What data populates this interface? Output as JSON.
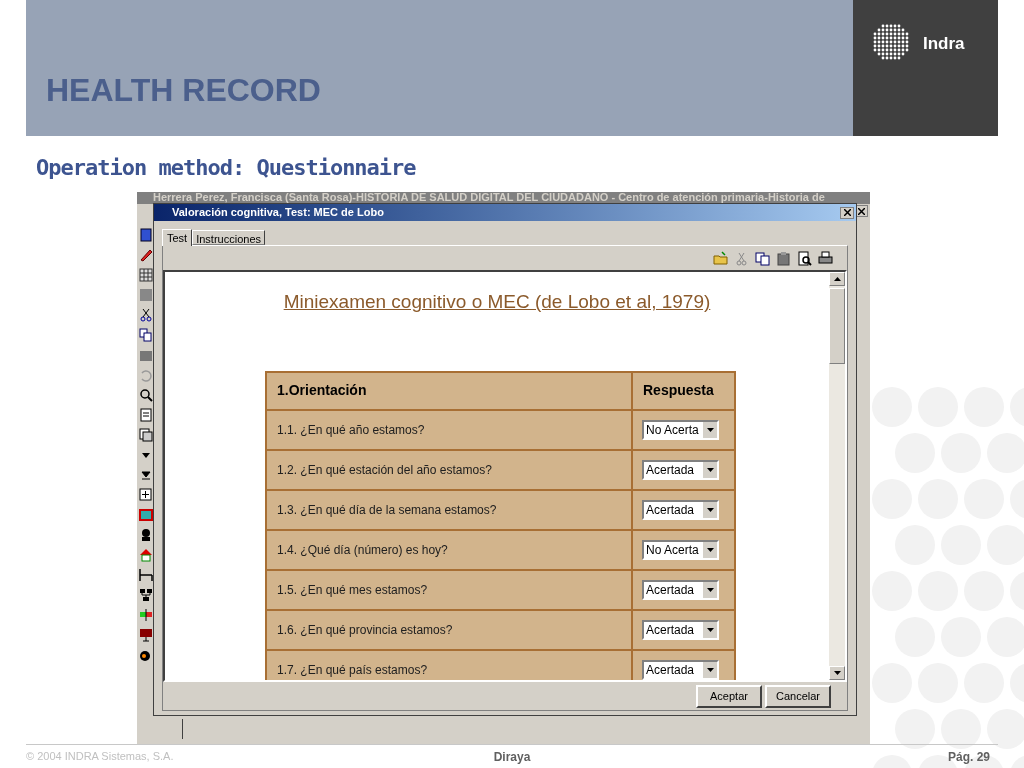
{
  "slide": {
    "title": "HEALTH RECORD",
    "logo_text": "Indra",
    "subtitle": "Operation method: Questionnaire"
  },
  "app_window": {
    "title": "Herrera Perez, Francisca (Santa Rosa)-HISTORIA DE SALUD DIGITAL DEL CIUDADANO - Centro de atención primaria-Historia de"
  },
  "dialog": {
    "title": "Valoración cognitiva, Test: MEC de Lobo",
    "tabs": [
      {
        "label": "Test",
        "selected": true
      },
      {
        "label": "Instrucciones",
        "selected": false
      }
    ],
    "heading": "Miniexamen cognitivo o MEC (de Lobo et al, 1979)",
    "table": {
      "columns": [
        "1.Orientación",
        "Respuesta"
      ],
      "rows": [
        {
          "question": "1.1. ¿En qué año estamos?",
          "answer": "No Acerta"
        },
        {
          "question": "1.2. ¿En qué estación del año estamos?",
          "answer": "Acertada"
        },
        {
          "question": "1.3. ¿En qué día de la semana estamos?",
          "answer": "Acertada"
        },
        {
          "question": "1.4. ¿Qué día (número) es hoy?",
          "answer": "No Acerta"
        },
        {
          "question": "1.5. ¿En qué mes estamos?",
          "answer": "Acertada"
        },
        {
          "question": "1.6. ¿En qué provincia estamos?",
          "answer": "Acertada"
        },
        {
          "question": "1.7. ¿En qué país estamos?",
          "answer": "Acertada"
        }
      ]
    },
    "buttons": [
      "Aceptar",
      "Cancelar"
    ]
  },
  "footer": {
    "copyright": "© 2004 INDRA Sistemas, S.A.",
    "center": "Diraya",
    "page": "Pág. 29"
  }
}
